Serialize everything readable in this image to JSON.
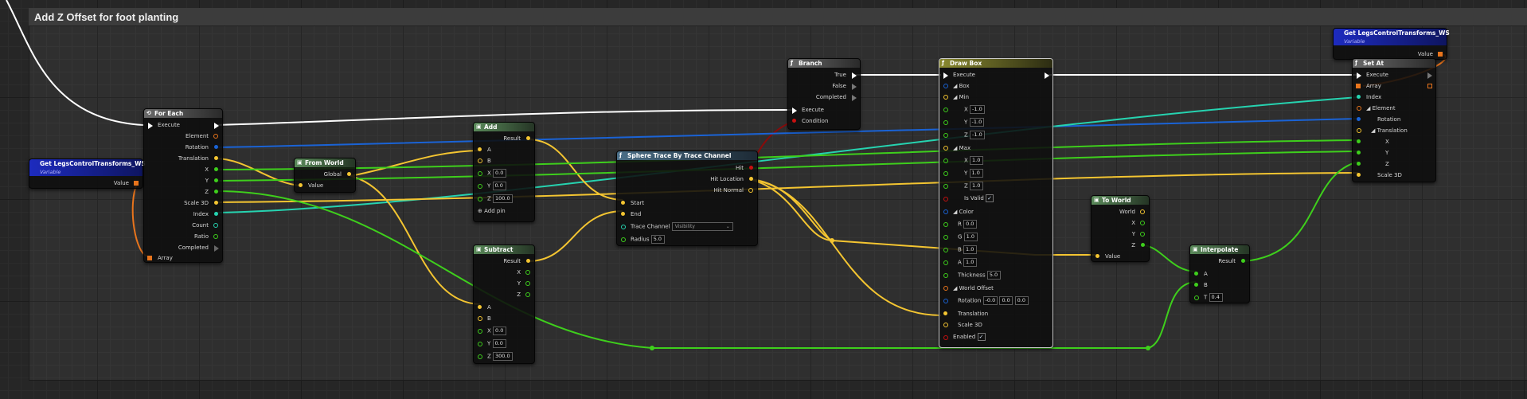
{
  "comment": {
    "title": "Add Z Offset for foot planting"
  },
  "var_left": {
    "title": "Get LegsControlTransforms_WS",
    "subtitle": "Variable",
    "output": "Value"
  },
  "var_right": {
    "title": "Get LegsControlTransforms_WS",
    "subtitle": "Variable",
    "output": "Value"
  },
  "for_each": {
    "title": "For Each",
    "exec_in": "Execute",
    "array_in": "Array",
    "outputs": [
      "Element",
      "Rotation",
      "Translation",
      "X",
      "Y",
      "Z",
      "Scale 3D",
      "Index",
      "Count",
      "Ratio",
      "Completed"
    ]
  },
  "from_world": {
    "title": "From World",
    "output": "Global",
    "input": "Value"
  },
  "add": {
    "title": "Add",
    "output": "Result",
    "in_a": "A",
    "in_b": "B",
    "x": "0.0",
    "y": "0.0",
    "z": "100.0",
    "add_pin": "Add pin"
  },
  "subtract": {
    "title": "Subtract",
    "output": "Result",
    "out_x": "X",
    "out_y": "Y",
    "out_z": "Z",
    "in_a": "A",
    "in_b": "B",
    "x": "0.0",
    "y": "0.0",
    "z": "300.0"
  },
  "sphere_trace": {
    "title": "Sphere Trace By Trace Channel",
    "outputs": [
      "Hit",
      "Hit Location",
      "Hit Normal"
    ],
    "start": "Start",
    "end": "End",
    "trace_channel_label": "Trace Channel",
    "trace_channel_value": "Visibility",
    "radius_label": "Radius",
    "radius": "5.0"
  },
  "branch": {
    "title": "Branch",
    "outputs": [
      "True",
      "False",
      "Completed"
    ],
    "exec_in": "Execute",
    "condition": "Condition"
  },
  "draw_box": {
    "title": "Draw Box",
    "execute": "Execute",
    "box": "Box",
    "min": "Min",
    "min_x": "-1.0",
    "min_y": "-1.0",
    "min_z": "-1.0",
    "max": "Max",
    "max_x": "1.0",
    "max_y": "1.0",
    "max_z": "1.0",
    "is_valid": "Is Valid",
    "color": "Color",
    "r": "0.0",
    "g": "1.0",
    "b": "1.0",
    "a": "1.0",
    "thickness_label": "Thickness",
    "thickness": "5.0",
    "world_offset": "World Offset",
    "rotation_label": "Rotation",
    "rot_x": "-0.0",
    "rot_y": "0.0",
    "rot_z": "0.0",
    "translation": "Translation",
    "scale3d": "Scale 3D",
    "enabled": "Enabled",
    "check": "✓"
  },
  "to_world": {
    "title": "To World",
    "outputs": [
      "World",
      "X",
      "Y",
      "Z"
    ],
    "input": "Value"
  },
  "interpolate": {
    "title": "Interpolate",
    "output": "Result",
    "in_a": "A",
    "in_b": "B",
    "t_label": "T",
    "t": "0.4"
  },
  "set_at": {
    "title": "Set At",
    "inputs": [
      "Execute",
      "Array",
      "Index",
      "Element",
      "Rotation",
      "Translation",
      "X",
      "Y",
      "Z",
      "Scale 3D"
    ]
  },
  "labels": {
    "x": "X",
    "y": "Y",
    "z": "Z",
    "r": "R",
    "g": "G",
    "b": "B",
    "a": "A"
  },
  "colors": {
    "exec": "#ffffff",
    "vector": "#f4c531",
    "float": "#3ecf1c",
    "rotator": "#1a63d6",
    "int": "#26d3b0",
    "array": "#e8741c",
    "bool": "#c81010"
  }
}
